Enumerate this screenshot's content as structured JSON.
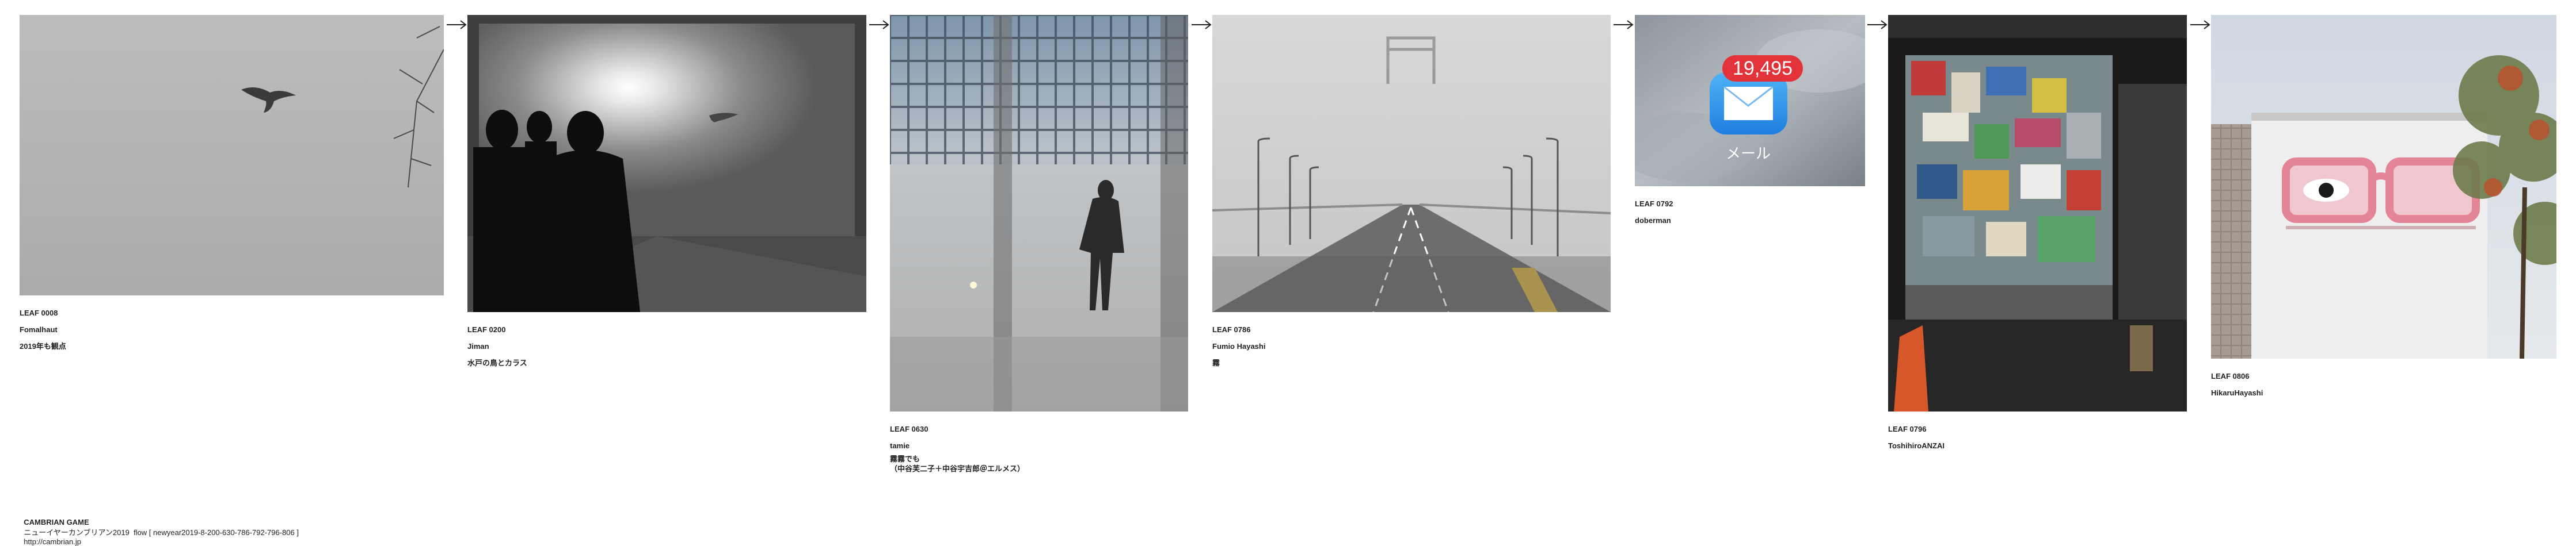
{
  "leaves": [
    {
      "id": "LEAF 0008",
      "author": "Fomalhaut",
      "title": "2019年も観点",
      "title2": ""
    },
    {
      "id": "LEAF 0200",
      "author": "Jiman",
      "title": "水戸の鳥とカラス",
      "title2": ""
    },
    {
      "id": "LEAF 0630",
      "author": "tamie",
      "title": "霧霧でも",
      "title2": "（中谷芙二子＋中谷宇吉郎＠エルメス）"
    },
    {
      "id": "LEAF 0786",
      "author": "Fumio Hayashi",
      "title": "霧",
      "title2": ""
    },
    {
      "id": "LEAF 0792",
      "author": "doberman",
      "title": "",
      "title2": ""
    },
    {
      "id": "LEAF 0796",
      "author": "ToshihiroANZAI",
      "title": "",
      "title2": ""
    },
    {
      "id": "LEAF 0806",
      "author": "HikaruHayashi",
      "title": "",
      "title2": ""
    }
  ],
  "mail_badge": "19,495",
  "mail_label": "メール",
  "footer": {
    "brand": "CAMBRIAN GAME",
    "flow": "ニューイヤーカンブリアン2019  flow [ newyear2019-8-200-630-786-792-796-806 ]",
    "url": "http://cambrian.jp"
  },
  "icons": [
    "flow-arrow-icon",
    "mail-icon"
  ]
}
